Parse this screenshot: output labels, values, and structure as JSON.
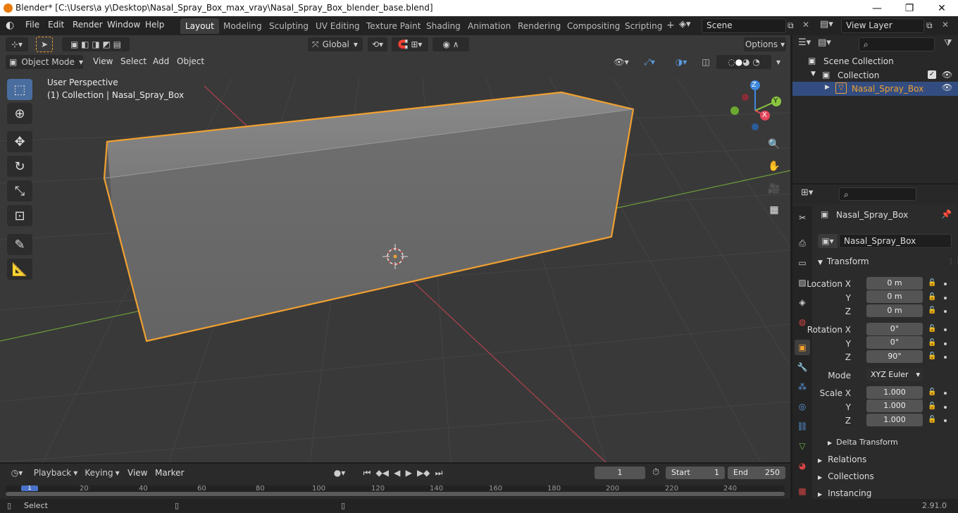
{
  "window": {
    "title": "Blender* [C:\\Users\\a y\\Desktop\\Nasal_Spray_Box_max_vray\\Nasal_Spray_Box_blender_base.blend]",
    "minimize": "—",
    "maximize": "❐",
    "close": "✕"
  },
  "menu": {
    "file": "File",
    "edit": "Edit",
    "render": "Render",
    "window": "Window",
    "help": "Help"
  },
  "workspaces": [
    "Layout",
    "Modeling",
    "Sculpting",
    "UV Editing",
    "Texture Paint",
    "Shading",
    "Animation",
    "Rendering",
    "Compositing",
    "Scripting"
  ],
  "active_workspace": "Layout",
  "scene": {
    "name": "Scene"
  },
  "view_layer": {
    "name": "View Layer"
  },
  "viewport": {
    "mode": "Object Mode",
    "menus": [
      "View",
      "Select",
      "Add",
      "Object"
    ],
    "transform_orientation": "Global",
    "options_label": "Options",
    "overlay_text_1": "User Perspective",
    "overlay_text_2": "(1) Collection | Nasal_Spray_Box",
    "gizmo": {
      "x": "X",
      "y": "Y",
      "z": "Z"
    }
  },
  "outliner": {
    "scene_collection": "Scene Collection",
    "collection": "Collection",
    "object": "Nasal_Spray_Box"
  },
  "properties": {
    "object_name": "Nasal_Spray_Box",
    "data_name": "Nasal_Spray_Box",
    "transform_header": "Transform",
    "location_label": "Location X",
    "y_label": "Y",
    "z_label": "Z",
    "rotation_label": "Rotation X",
    "mode_label": "Mode",
    "scale_label": "Scale X",
    "location": [
      "0 m",
      "0 m",
      "0 m"
    ],
    "rotation": [
      "0°",
      "0°",
      "90°"
    ],
    "rotation_mode": "XYZ Euler",
    "scale": [
      "1.000",
      "1.000",
      "1.000"
    ],
    "delta_transform": "Delta Transform",
    "relations": "Relations",
    "collections": "Collections",
    "instancing": "Instancing"
  },
  "timeline": {
    "menus": [
      "Playback",
      "Keying",
      "View",
      "Marker"
    ],
    "current_frame": "1",
    "start_label": "Start",
    "start": "1",
    "end_label": "End",
    "end": "250",
    "ruler": [
      "1",
      "20",
      "40",
      "60",
      "80",
      "100",
      "120",
      "140",
      "160",
      "180",
      "200",
      "220",
      "240"
    ]
  },
  "status": {
    "select": "Select",
    "version": "2.91.0"
  },
  "colors": {
    "accent": "#4a6d9f",
    "selection_outline": "#f0a030",
    "x_axis": "#e2475c",
    "y_axis": "#8bc540",
    "z_axis": "#3e88e0"
  }
}
